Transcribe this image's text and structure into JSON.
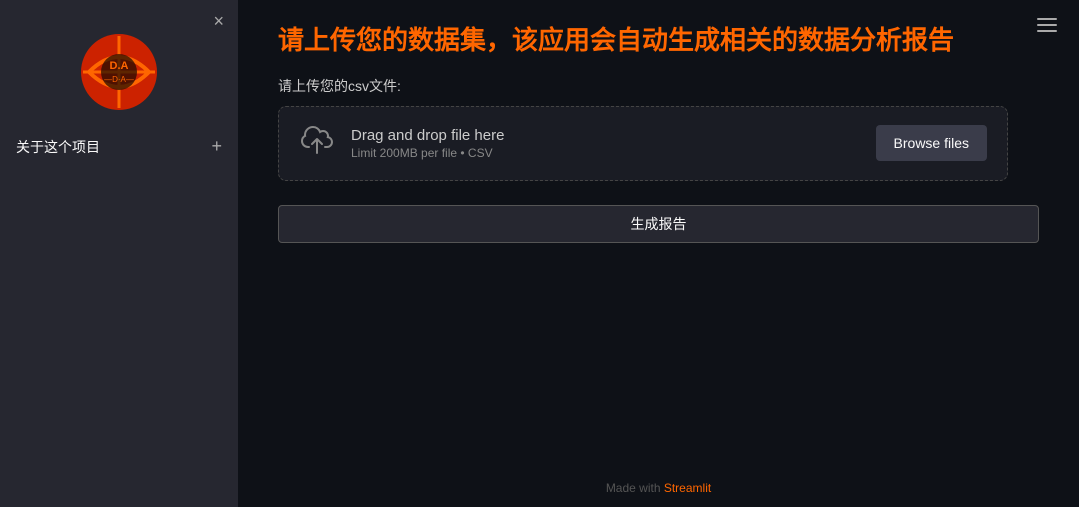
{
  "sidebar": {
    "close_icon": "×",
    "about_label": "关于这个项目",
    "about_plus": "+"
  },
  "header": {
    "title": "请上传您的数据集，该应用会自动生成相关的数据分析报告"
  },
  "upload": {
    "label": "请上传您的csv文件:",
    "drag_text": "Drag and drop file here",
    "limit_text": "Limit 200MB per file • CSV",
    "browse_label": "Browse files"
  },
  "generate_btn": "生成报告",
  "footer": {
    "text_before": "Made with ",
    "link_text": "Streamlit",
    "text_after": ""
  }
}
